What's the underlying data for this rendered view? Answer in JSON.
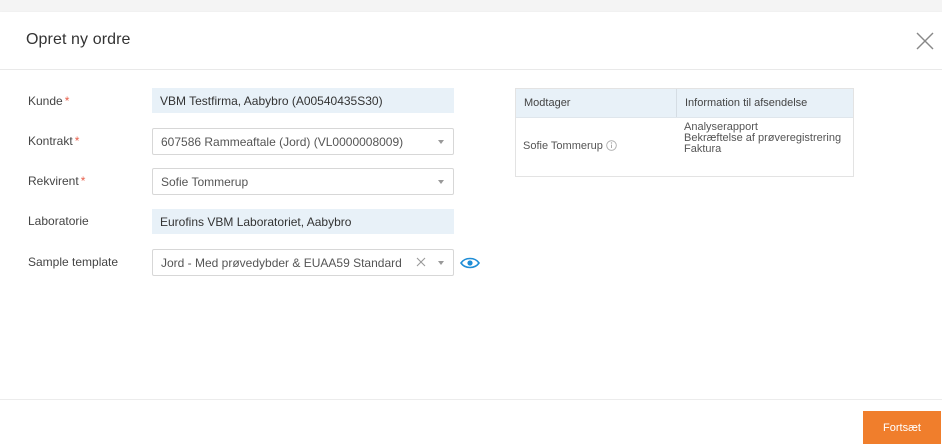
{
  "dialog": {
    "title": "Opret ny ordre"
  },
  "form": {
    "kunde": {
      "label": "Kunde",
      "required_mark": "*",
      "value": "VBM Testfirma, Aabybro (A00540435S30)"
    },
    "kontrakt": {
      "label": "Kontrakt",
      "required_mark": "*",
      "value": "607586 Rammeaftale (Jord) (VL0000008009)"
    },
    "rekvirent": {
      "label": "Rekvirent",
      "required_mark": "*",
      "value": "Sofie Tommerup"
    },
    "laboratorie": {
      "label": "Laboratorie",
      "value": "Eurofins VBM Laboratoriet, Aabybro"
    },
    "sample_template": {
      "label": "Sample template",
      "value": "Jord - Med prøvedybder & EUAA59 Standard"
    }
  },
  "recipients_table": {
    "headers": [
      "Modtager",
      "Information til afsendelse"
    ],
    "rows": [
      {
        "recipient": "Sofie Tommerup",
        "info_lines": [
          "Analyserapport",
          "Bekræftelse af prøveregistrering",
          "Faktura"
        ]
      }
    ]
  },
  "actions": {
    "continue_label": "Fortsæt"
  },
  "colors": {
    "accent": "#f07e2c",
    "required": "#e8604c",
    "readonly_bg": "#e8f1f8",
    "eye_icon": "#1f8dd6"
  },
  "icons": {
    "close": "close-icon",
    "caret": "chevron-down-icon",
    "clear": "clear-icon",
    "preview": "eye-icon",
    "info": "info-icon"
  }
}
